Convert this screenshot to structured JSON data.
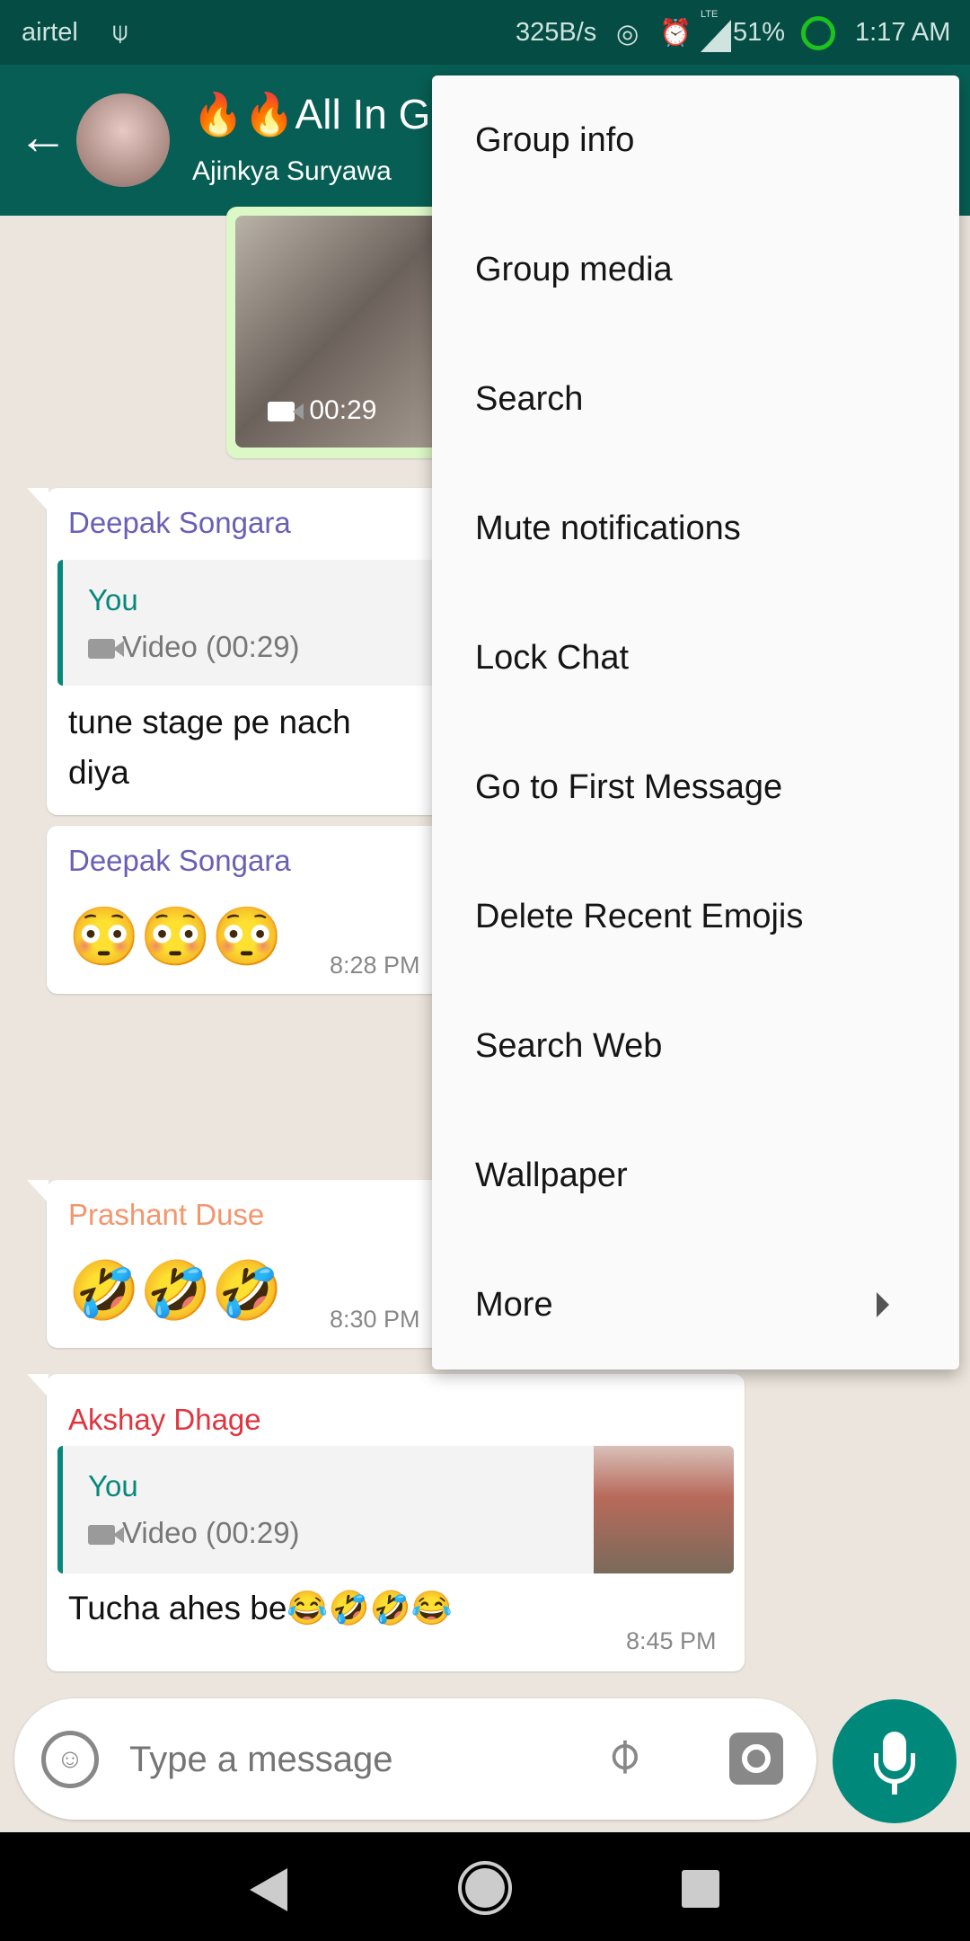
{
  "status_bar": {
    "carrier": "airtel",
    "speed": "325B/s",
    "network": "LTE",
    "battery": "51%",
    "time": "1:17 AM"
  },
  "header": {
    "title": "🔥🔥All In G",
    "subtitle": "Ajinkya Suryawa"
  },
  "video_message": {
    "duration": "00:29"
  },
  "messages": [
    {
      "sender": "Deepak Songara",
      "sender_color": "#6a5fb5",
      "quote_author": "You",
      "quote_text": "Video (00:29)",
      "text": "tune stage pe nach",
      "text2": "diya"
    },
    {
      "sender": "Deepak Songara",
      "sender_color": "#6a5fb5",
      "text": "😳😳😳",
      "time": "8:28 PM"
    },
    {
      "sender": "Prashant Duse",
      "sender_color": "#f4956c",
      "text": "🤣🤣🤣",
      "time": "8:30 PM"
    },
    {
      "sender": "Akshay Dhage",
      "sender_color": "#e0343f",
      "quote_author": "You",
      "quote_text": "Video (00:29)",
      "text": "Tucha ahes be😂🤣🤣😂",
      "time": "8:45 PM"
    }
  ],
  "menu": {
    "items": [
      "Group info",
      "Group media",
      "Search",
      "Mute notifications",
      "Lock Chat",
      "Go to First Message",
      "Delete Recent Emojis",
      "Search Web",
      "Wallpaper",
      "More"
    ]
  },
  "input": {
    "placeholder": "Type a message"
  },
  "colors": {
    "header": "#075e54",
    "status": "#054c44",
    "accent": "#00897b",
    "outgoing": "#dcf8c6"
  }
}
